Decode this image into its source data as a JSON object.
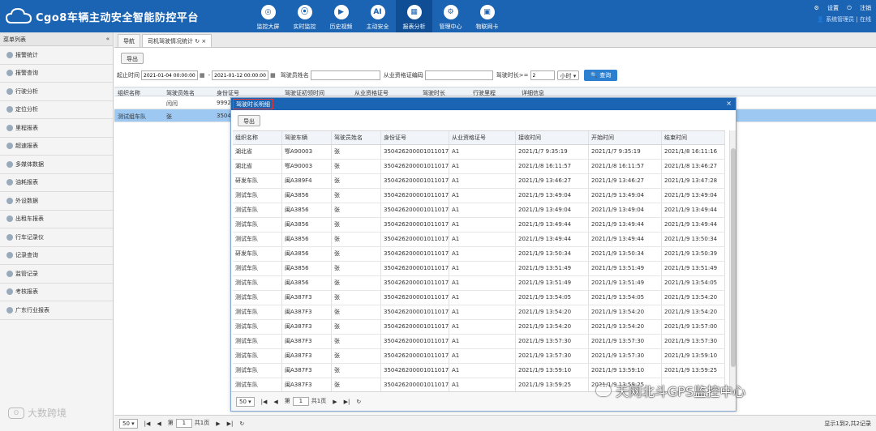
{
  "header": {
    "title": "Cgo8车辆主动安全智能防控平台",
    "nav": [
      {
        "label": "监控大屏",
        "icon": "monitor-screen-icon",
        "glyph": "◎"
      },
      {
        "label": "实时监控",
        "icon": "location-icon",
        "glyph": "⦿"
      },
      {
        "label": "历史视频",
        "icon": "video-play-icon",
        "glyph": "▶"
      },
      {
        "label": "主动安全",
        "icon": "ai-shield-icon",
        "glyph": "AI"
      },
      {
        "label": "报表分析",
        "icon": "report-icon",
        "glyph": "▦"
      },
      {
        "label": "管理中心",
        "icon": "gear-icon",
        "glyph": "⚙"
      },
      {
        "label": "物联网卡",
        "icon": "sim-card-icon",
        "glyph": "▣"
      }
    ],
    "settings": "设置",
    "logout": "注销",
    "user": "系统管理员 | 在线"
  },
  "sidebar": {
    "title": "菜单列表",
    "collapse": "«",
    "items": [
      "报警统计",
      "报警查询",
      "行驶分析",
      "定位分析",
      "里程报表",
      "超速报表",
      "多媒体数据",
      "油耗报表",
      "外设数据",
      "出租车报表",
      "行车记录仪",
      "记录查询",
      "监管记录",
      "考核报表",
      "广东行业报表"
    ]
  },
  "watermark_left": "大数跨境",
  "tabs": [
    {
      "label": "导航"
    },
    {
      "label": "司机驾驶情况统计 ↻ ×"
    }
  ],
  "toolbar": {
    "export": "导出"
  },
  "filter": {
    "time_label": "起止时间",
    "start": "2021-01-04 00:00:00",
    "sep": "-",
    "end": "2021-01-12 00:00:00",
    "driver_label": "驾驶员姓名",
    "cert_label": "从业资格证编码",
    "duration_label": "驾驶时长>=",
    "duration_value": "2",
    "unit": "小时",
    "query": "查询"
  },
  "bg_table": {
    "headers": [
      "组织名称",
      "驾驶员姓名",
      "身份证号",
      "驾驶证初领时间",
      "从业资格证号",
      "驾驶时长",
      "行驶里程",
      "详细信息"
    ],
    "rows": [
      [
        "",
        "闫闫",
        "9992",
        ""
      ],
      [
        "测试组车队",
        "张",
        "3504",
        ""
      ]
    ]
  },
  "pager": {
    "size": "50 ▾",
    "page_label": "第",
    "page": "1",
    "total_pages": "共1页",
    "info": "显示1到2,共2记录"
  },
  "dialog": {
    "title": "驾驶时长明细",
    "close": "×",
    "export": "导出",
    "headers": [
      "组织名称",
      "驾驶车辆",
      "驾驶员姓名",
      "身份证号",
      "从业资格证号",
      "接收时间",
      "开始时间",
      "结束时间"
    ],
    "rows": [
      [
        "湖北省",
        "鄂A90003",
        "张",
        "350426200001011017",
        "A1",
        "2021/1/7 9:35:19",
        "2021/1/7 9:35:19",
        "2021/1/8 16:11:16"
      ],
      [
        "湖北省",
        "鄂A90003",
        "张",
        "350426200001011017",
        "A1",
        "2021/1/8 16:11:57",
        "2021/1/8 16:11:57",
        "2021/1/8 13:46:27"
      ],
      [
        "研发车队",
        "闽A389F4",
        "张",
        "350426200001011017",
        "A1",
        "2021/1/9 13:46:27",
        "2021/1/9 13:46:27",
        "2021/1/9 13:47:28"
      ],
      [
        "测试车队",
        "闽A3856",
        "张",
        "350426200001011017",
        "A1",
        "2021/1/9 13:49:04",
        "2021/1/9 13:49:04",
        "2021/1/9 13:49:04"
      ],
      [
        "测试车队",
        "闽A3856",
        "张",
        "350426200001011017",
        "A1",
        "2021/1/9 13:49:04",
        "2021/1/9 13:49:04",
        "2021/1/9 13:49:44"
      ],
      [
        "测试车队",
        "闽A3856",
        "张",
        "350426200001011017",
        "A1",
        "2021/1/9 13:49:44",
        "2021/1/9 13:49:44",
        "2021/1/9 13:49:44"
      ],
      [
        "测试车队",
        "闽A3856",
        "张",
        "350426200001011017",
        "A1",
        "2021/1/9 13:49:44",
        "2021/1/9 13:49:44",
        "2021/1/9 13:50:34"
      ],
      [
        "研发车队",
        "闽A3856",
        "张",
        "350426200001011017",
        "A1",
        "2021/1/9 13:50:34",
        "2021/1/9 13:50:34",
        "2021/1/9 13:50:39"
      ],
      [
        "测试车队",
        "闽A3856",
        "张",
        "350426200001011017",
        "A1",
        "2021/1/9 13:51:49",
        "2021/1/9 13:51:49",
        "2021/1/9 13:51:49"
      ],
      [
        "测试车队",
        "闽A3856",
        "张",
        "350426200001011017",
        "A1",
        "2021/1/9 13:51:49",
        "2021/1/9 13:51:49",
        "2021/1/9 13:54:05"
      ],
      [
        "测试车队",
        "闽A387F3",
        "张",
        "350426200001011017",
        "A1",
        "2021/1/9 13:54:05",
        "2021/1/9 13:54:05",
        "2021/1/9 13:54:20"
      ],
      [
        "测试车队",
        "闽A387F3",
        "张",
        "350426200001011017",
        "A1",
        "2021/1/9 13:54:20",
        "2021/1/9 13:54:20",
        "2021/1/9 13:54:20"
      ],
      [
        "测试车队",
        "闽A387F3",
        "张",
        "350426200001011017",
        "A1",
        "2021/1/9 13:54:20",
        "2021/1/9 13:54:20",
        "2021/1/9 13:57:00"
      ],
      [
        "测试车队",
        "闽A387F3",
        "张",
        "350426200001011017",
        "A1",
        "2021/1/9 13:57:30",
        "2021/1/9 13:57:30",
        "2021/1/9 13:57:30"
      ],
      [
        "测试车队",
        "闽A387F3",
        "张",
        "350426200001011017",
        "A1",
        "2021/1/9 13:57:30",
        "2021/1/9 13:57:30",
        "2021/1/9 13:59:10"
      ],
      [
        "测试车队",
        "闽A387F3",
        "张",
        "350426200001011017",
        "A1",
        "2021/1/9 13:59:10",
        "2021/1/9 13:59:10",
        "2021/1/9 13:59:25"
      ],
      [
        "测试车队",
        "闽A387F3",
        "张",
        "350426200001011017",
        "A1",
        "2021/1/9 13:59:25",
        "2021/1/9 13:59:25",
        ""
      ]
    ],
    "pager": {
      "size": "50 ▾",
      "page_label": "第",
      "page": "1",
      "total_pages": "共1页"
    }
  },
  "watermark_right": "天网北斗GPS监控中心"
}
